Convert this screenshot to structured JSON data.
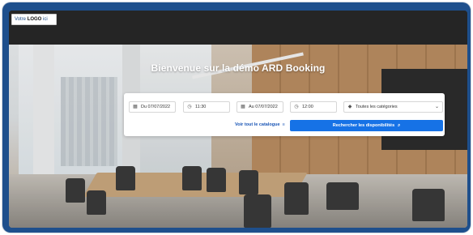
{
  "header": {
    "logo_prefix": "Votre",
    "logo_bold": "LOGO",
    "logo_suffix": "ici"
  },
  "hero": {
    "title": "Bienvenue sur la démo ARD Booking"
  },
  "search": {
    "start_date": "Du 07/07/2022",
    "start_time": "11:30",
    "end_date": "Au 07/07/2022",
    "end_time": "12:00",
    "category": "Toutes les catégories",
    "catalog_link": "Voir tout le catalogue",
    "submit_label": "Rechercher les disponibilités"
  },
  "icons": {
    "calendar": "calendar-icon",
    "clock": "clock-icon",
    "tag": "tag-icon",
    "chevron": "chevron-down-icon",
    "list": "list-icon",
    "search": "search-icon"
  },
  "colors": {
    "frame": "#1e4f8c",
    "primary_button": "#1672e6",
    "link": "#1a56b6",
    "topbar": "#252525"
  }
}
